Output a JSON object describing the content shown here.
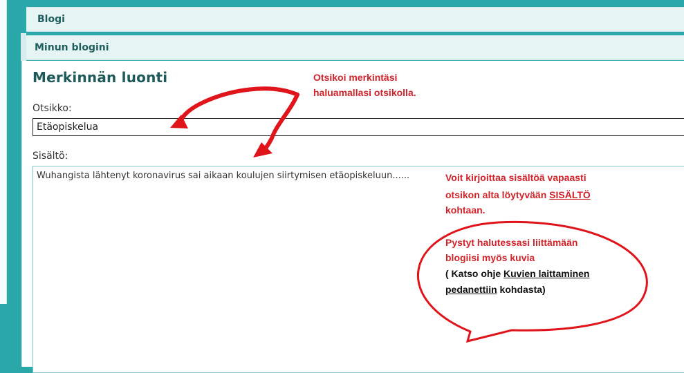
{
  "nav": {
    "blog_tab": "Blogi",
    "my_blog_tab": "Minun blogini"
  },
  "page": {
    "heading": "Merkinnän luonti"
  },
  "form": {
    "title_label": "Otsikko:",
    "title_value": "Etäopiskelua",
    "content_label": "Sisältö:",
    "content_value": "Wuhangista lähtenyt koronavirus sai aikaan koulujen siirtymisen etäopiskeluun......"
  },
  "annotations": {
    "title_hint_line1": "Otsikoi merkintäsi",
    "title_hint_line2": "haluamallasi otsikolla.",
    "content_hint_line1": "Voit kirjoittaa sisältöä vapaasti",
    "content_hint_line2_a": "otsikon alta löytyvään ",
    "content_hint_line2_b": "SISÄLTÖ",
    "content_hint_line3": "kohtaan.",
    "bubble_line1": "Pystyt halutessasi liittämään",
    "bubble_line2": "blogiisi myös kuvia",
    "bubble_line3_a": "( Katso ohje ",
    "bubble_line3_b": "Kuvien laittaminen",
    "bubble_line4_a": "pedanettiin",
    "bubble_line4_b": " kohdasta)"
  },
  "colors": {
    "background": "#2aa7a8",
    "heading": "#1f5a5a",
    "annotation": "#d0232a"
  }
}
